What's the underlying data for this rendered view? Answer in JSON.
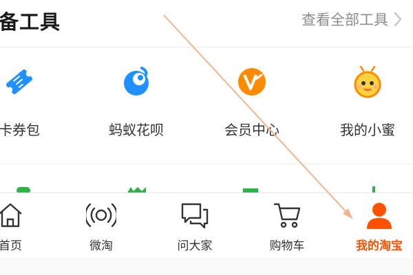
{
  "section": {
    "title": "备工具",
    "view_all": "查看全部工具"
  },
  "tools": [
    {
      "label": "卡券包",
      "icon": "ticket-icon"
    },
    {
      "label": "蚂蚁花呗",
      "icon": "huabei-icon"
    },
    {
      "label": "会员中心",
      "icon": "vip-icon"
    },
    {
      "label": "我的小蜜",
      "icon": "bee-icon"
    }
  ],
  "tabbar": {
    "tabs": [
      {
        "label": "首页",
        "icon": "home-icon"
      },
      {
        "label": "微淘",
        "icon": "broadcast-icon"
      },
      {
        "label": "问大家",
        "icon": "chat-icon"
      },
      {
        "label": "购物车",
        "icon": "cart-icon"
      },
      {
        "label": "我的淘宝",
        "icon": "user-icon"
      }
    ],
    "active_index": 4
  },
  "colors": {
    "accent": "#ff5000",
    "blue": "#1e90ff",
    "orange": "#ff8a00",
    "green": "#2db34a",
    "arrow": "#f5b48a"
  }
}
